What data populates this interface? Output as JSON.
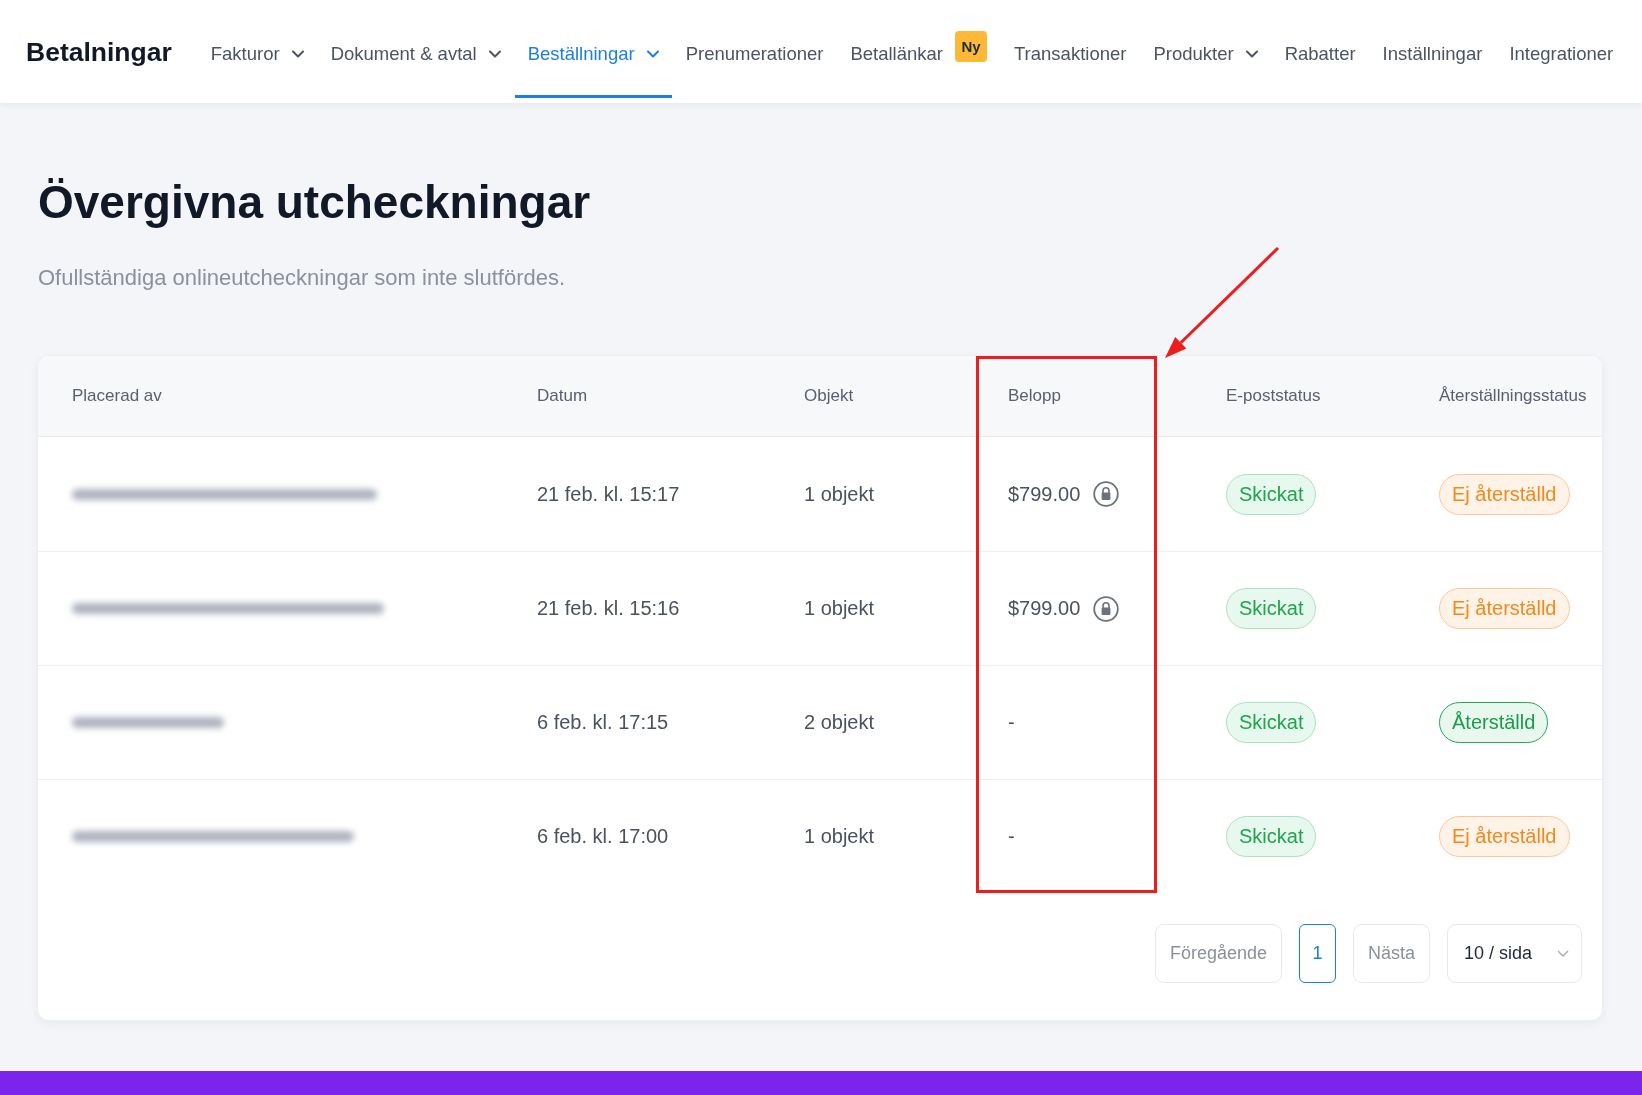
{
  "nav": {
    "title": "Betalningar",
    "items": [
      {
        "label": "Fakturor",
        "has_menu": true,
        "selected": false
      },
      {
        "label": "Dokument & avtal",
        "has_menu": true,
        "selected": false
      },
      {
        "label": "Beställningar",
        "has_menu": true,
        "selected": true
      },
      {
        "label": "Prenumerationer",
        "has_menu": false,
        "selected": false
      },
      {
        "label": "Betallänkar",
        "has_menu": false,
        "selected": false,
        "badge": "Ny"
      },
      {
        "label": "Transaktioner",
        "has_menu": false,
        "selected": false
      },
      {
        "label": "Produkter",
        "has_menu": true,
        "selected": false
      },
      {
        "label": "Rabatter",
        "has_menu": false,
        "selected": false
      },
      {
        "label": "Inställningar",
        "has_menu": false,
        "selected": false
      },
      {
        "label": "Integrationer",
        "has_menu": false,
        "selected": false
      }
    ]
  },
  "page": {
    "title": "Övergivna utcheckningar",
    "subtitle": "Ofullständiga onlineutcheckningar som inte slutfördes."
  },
  "table": {
    "columns": [
      {
        "label": "Placerad av",
        "highlighted": false
      },
      {
        "label": "Datum",
        "highlighted": false
      },
      {
        "label": "Objekt",
        "highlighted": false
      },
      {
        "label": "Belopp",
        "highlighted": true
      },
      {
        "label": "E-poststatus",
        "highlighted": false
      },
      {
        "label": "Återställningsstatus",
        "highlighted": false
      }
    ],
    "rows": [
      {
        "date": "21 feb. kl. 15:17",
        "items": "1 objekt",
        "amount": "$799.00",
        "locked": true,
        "email_status": {
          "label": "Skickat",
          "kind": "sent"
        },
        "recovery_status": {
          "label": "Ej återställd",
          "kind": "not_recovered"
        }
      },
      {
        "date": "21 feb. kl. 15:16",
        "items": "1 objekt",
        "amount": "$799.00",
        "locked": true,
        "email_status": {
          "label": "Skickat",
          "kind": "sent"
        },
        "recovery_status": {
          "label": "Ej återställd",
          "kind": "not_recovered"
        }
      },
      {
        "date": "6 feb. kl. 17:15",
        "items": "2 objekt",
        "amount": "-",
        "locked": false,
        "email_status": {
          "label": "Skickat",
          "kind": "sent"
        },
        "recovery_status": {
          "label": "Återställd",
          "kind": "recovered"
        }
      },
      {
        "date": "6 feb. kl. 17:00",
        "items": "1 objekt",
        "amount": "-",
        "locked": false,
        "email_status": {
          "label": "Skickat",
          "kind": "sent"
        },
        "recovery_status": {
          "label": "Ej återställd",
          "kind": "not_recovered"
        }
      }
    ]
  },
  "pagination": {
    "previous": {
      "label": "Föregående",
      "disabled": true
    },
    "pages": [
      {
        "label": "1",
        "selected": true
      }
    ],
    "next": {
      "label": "Nästa",
      "disabled": true
    },
    "page_size": "10 / sida"
  }
}
